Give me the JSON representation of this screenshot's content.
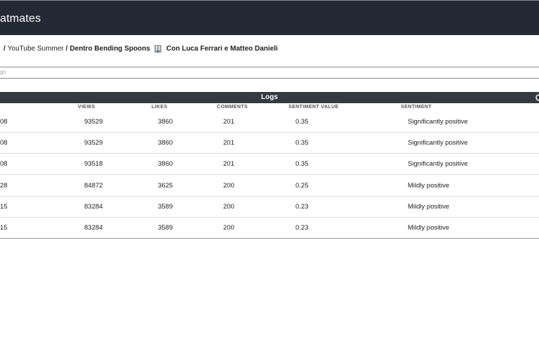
{
  "app": {
    "title": "atmates"
  },
  "breadcrumb": {
    "items": [
      "YouTube Summer"
    ],
    "current": "Dentro Bending Spoons",
    "current_suffix": "Con Luca Ferrari e Matteo Danieli",
    "icon": "building-icon"
  },
  "search": {
    "placeholder": "gs"
  },
  "logs": {
    "title": "Logs",
    "columns": [
      "VIEWS",
      "LIKES",
      "COMMENTS",
      "SENTIMENT VALUE",
      "SENTIMENT"
    ],
    "rows": [
      {
        "date": "08",
        "views": "93529",
        "likes": "3860",
        "comments": "201",
        "sentiment_value": "0.35",
        "sentiment": "Significantly positive"
      },
      {
        "date": "08",
        "views": "93529",
        "likes": "3860",
        "comments": "201",
        "sentiment_value": "0.35",
        "sentiment": "Significantly positive"
      },
      {
        "date": "08",
        "views": "93518",
        "likes": "3860",
        "comments": "201",
        "sentiment_value": "0.35",
        "sentiment": "Significantly positive"
      },
      {
        "date": "28",
        "views": "84872",
        "likes": "3625",
        "comments": "200",
        "sentiment_value": "0.25",
        "sentiment": "Mildly positive"
      },
      {
        "date": "15",
        "views": "83284",
        "likes": "3589",
        "comments": "200",
        "sentiment_value": "0.23",
        "sentiment": "Mildly positive"
      },
      {
        "date": "15",
        "views": "83284",
        "likes": "3589",
        "comments": "200",
        "sentiment_value": "0.23",
        "sentiment": "Mildly positive"
      }
    ]
  }
}
